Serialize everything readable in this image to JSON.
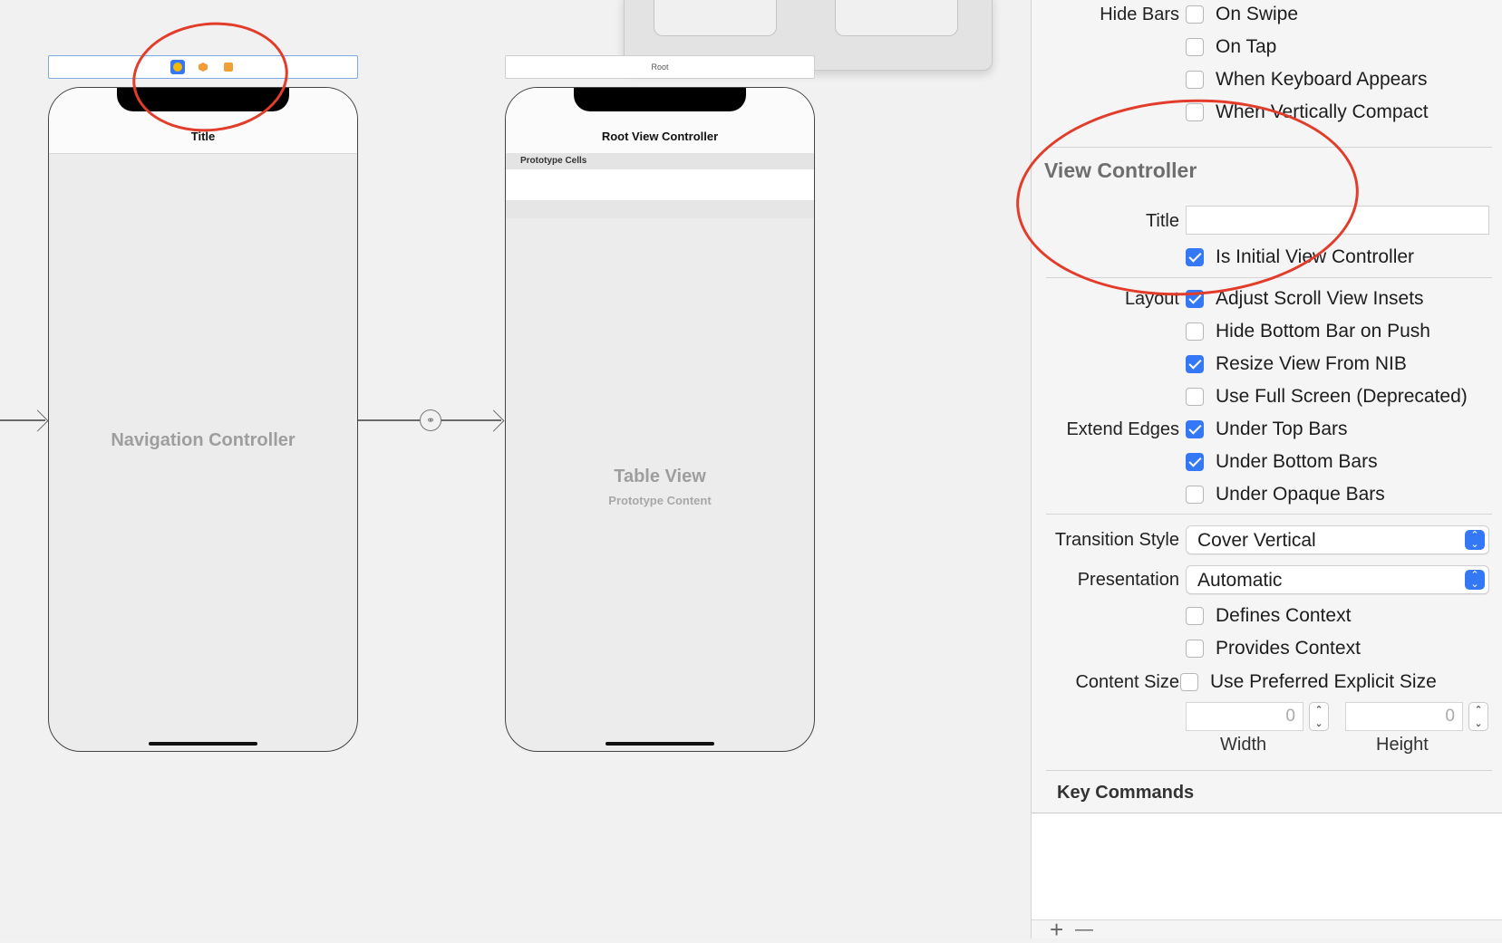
{
  "canvas": {
    "nav_controller": {
      "title": "Title",
      "center_label": "Navigation Controller",
      "dock_icons": [
        "view-controller-icon",
        "first-responder-icon",
        "exit-icon"
      ]
    },
    "root_controller": {
      "bar_label": "Root",
      "title": "Root View Controller",
      "prototype_header": "Prototype Cells",
      "center_label": "Table View",
      "center_sublabel": "Prototype Content"
    }
  },
  "inspector": {
    "hide_bars": {
      "label": "Hide Bars",
      "options": [
        {
          "label": "On Swipe",
          "checked": false
        },
        {
          "label": "On Tap",
          "checked": false
        },
        {
          "label": "When Keyboard Appears",
          "checked": false
        },
        {
          "label": "When Vertically Compact",
          "checked": false
        }
      ]
    },
    "view_controller": {
      "section_title": "View Controller",
      "title_label": "Title",
      "title_value": "",
      "is_initial_label": "Is Initial View Controller",
      "is_initial_checked": true
    },
    "layout": {
      "label": "Layout",
      "options": [
        {
          "label": "Adjust Scroll View Insets",
          "checked": true
        },
        {
          "label": "Hide Bottom Bar on Push",
          "checked": false
        },
        {
          "label": "Resize View From NIB",
          "checked": true
        },
        {
          "label": "Use Full Screen (Deprecated)",
          "checked": false
        }
      ]
    },
    "extend_edges": {
      "label": "Extend Edges",
      "options": [
        {
          "label": "Under Top Bars",
          "checked": true
        },
        {
          "label": "Under Bottom Bars",
          "checked": true
        },
        {
          "label": "Under Opaque Bars",
          "checked": false
        }
      ]
    },
    "transition_style": {
      "label": "Transition Style",
      "value": "Cover Vertical"
    },
    "presentation": {
      "label": "Presentation",
      "value": "Automatic"
    },
    "context": {
      "options": [
        {
          "label": "Defines Context",
          "checked": false
        },
        {
          "label": "Provides Context",
          "checked": false
        }
      ]
    },
    "content_size": {
      "label": "Content Size",
      "option_label": "Use Preferred Explicit Size",
      "checked": false,
      "width_value": "0",
      "height_value": "0",
      "width_label": "Width",
      "height_label": "Height"
    },
    "key_commands": {
      "title": "Key Commands",
      "add": "+",
      "remove": "—"
    }
  },
  "colors": {
    "accent": "#3478f6",
    "annotation": "#e23c2a"
  }
}
